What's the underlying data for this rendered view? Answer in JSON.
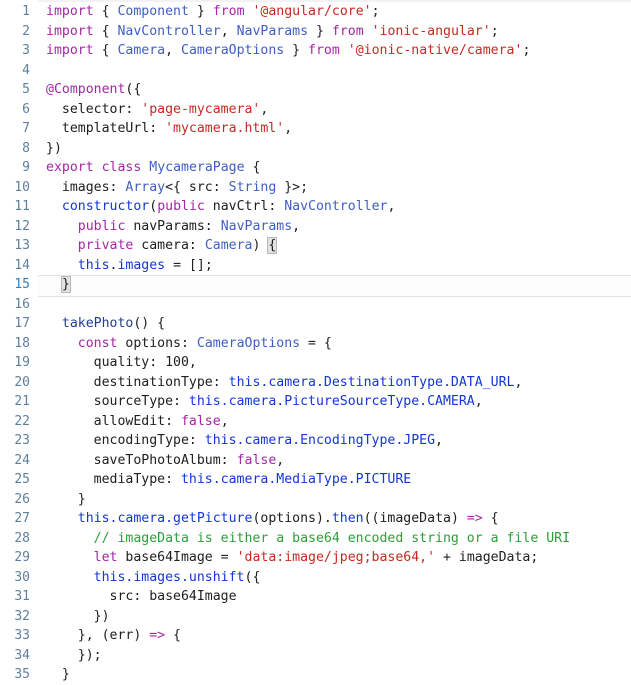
{
  "editor": {
    "name": "code-editor",
    "language": "TypeScript",
    "current_line": 15,
    "gutter": {
      "first_line": 1,
      "last_line": 35
    },
    "colors": {
      "background": "#ffffff",
      "line_number": "#5f7f9f",
      "current_line_number": "#2f7fbf",
      "keyword": "#a626a4",
      "type": "#3f5fc0",
      "string": "#c32b22",
      "comment": "#2d9e38",
      "member": "#1436d6",
      "function": "#1e3f8f",
      "plain_text": "#202020",
      "bracket_match_bg": "#e2e2e2",
      "current_line_border": "#e4e4e4"
    }
  },
  "lines": [
    {
      "n": "1",
      "tokens": [
        {
          "t": "kw",
          "v": "import"
        },
        {
          "t": "plain",
          "v": " { "
        },
        {
          "t": "type",
          "v": "Component"
        },
        {
          "t": "plain",
          "v": " } "
        },
        {
          "t": "kw",
          "v": "from"
        },
        {
          "t": "plain",
          "v": " "
        },
        {
          "t": "str",
          "v": "'@angular/core'"
        },
        {
          "t": "plain",
          "v": ";"
        }
      ]
    },
    {
      "n": "2",
      "tokens": [
        {
          "t": "kw",
          "v": "import"
        },
        {
          "t": "plain",
          "v": " { "
        },
        {
          "t": "type",
          "v": "NavController"
        },
        {
          "t": "plain",
          "v": ", "
        },
        {
          "t": "type",
          "v": "NavParams"
        },
        {
          "t": "plain",
          "v": " } "
        },
        {
          "t": "kw",
          "v": "from"
        },
        {
          "t": "plain",
          "v": " "
        },
        {
          "t": "str",
          "v": "'ionic-angular'"
        },
        {
          "t": "plain",
          "v": ";"
        }
      ]
    },
    {
      "n": "3",
      "tokens": [
        {
          "t": "kw",
          "v": "import"
        },
        {
          "t": "plain",
          "v": " { "
        },
        {
          "t": "type",
          "v": "Camera"
        },
        {
          "t": "plain",
          "v": ", "
        },
        {
          "t": "type",
          "v": "CameraOptions"
        },
        {
          "t": "plain",
          "v": " } "
        },
        {
          "t": "kw",
          "v": "from"
        },
        {
          "t": "plain",
          "v": " "
        },
        {
          "t": "str",
          "v": "'@ionic-native/camera'"
        },
        {
          "t": "plain",
          "v": ";"
        }
      ]
    },
    {
      "n": "4",
      "tokens": []
    },
    {
      "n": "5",
      "tokens": [
        {
          "t": "kw",
          "v": "@Component"
        },
        {
          "t": "plain",
          "v": "({"
        }
      ]
    },
    {
      "n": "6",
      "tokens": [
        {
          "t": "plain",
          "v": "  selector: "
        },
        {
          "t": "str",
          "v": "'page-mycamera'"
        },
        {
          "t": "plain",
          "v": ","
        }
      ]
    },
    {
      "n": "7",
      "tokens": [
        {
          "t": "plain",
          "v": "  templateUrl: "
        },
        {
          "t": "str",
          "v": "'mycamera.html'"
        },
        {
          "t": "plain",
          "v": ","
        }
      ]
    },
    {
      "n": "8",
      "tokens": [
        {
          "t": "plain",
          "v": "})"
        }
      ]
    },
    {
      "n": "9",
      "tokens": [
        {
          "t": "kw",
          "v": "export"
        },
        {
          "t": "plain",
          "v": " "
        },
        {
          "t": "kw",
          "v": "class"
        },
        {
          "t": "plain",
          "v": " "
        },
        {
          "t": "type",
          "v": "MycameraPage"
        },
        {
          "t": "plain",
          "v": " {"
        }
      ]
    },
    {
      "n": "10",
      "tokens": [
        {
          "t": "plain",
          "v": "  images: "
        },
        {
          "t": "type",
          "v": "Array"
        },
        {
          "t": "plain",
          "v": "<{ src: "
        },
        {
          "t": "type",
          "v": "String"
        },
        {
          "t": "plain",
          "v": " }>;"
        }
      ]
    },
    {
      "n": "11",
      "tokens": [
        {
          "t": "plain",
          "v": "  "
        },
        {
          "t": "ctor",
          "v": "constructor"
        },
        {
          "t": "plain",
          "v": "("
        },
        {
          "t": "kw",
          "v": "public"
        },
        {
          "t": "plain",
          "v": " navCtrl: "
        },
        {
          "t": "type",
          "v": "NavController"
        },
        {
          "t": "plain",
          "v": ","
        }
      ]
    },
    {
      "n": "12",
      "tokens": [
        {
          "t": "plain",
          "v": "    "
        },
        {
          "t": "kw",
          "v": "public"
        },
        {
          "t": "plain",
          "v": " navParams: "
        },
        {
          "t": "type",
          "v": "NavParams"
        },
        {
          "t": "plain",
          "v": ","
        }
      ]
    },
    {
      "n": "13",
      "tokens": [
        {
          "t": "plain",
          "v": "    "
        },
        {
          "t": "kw",
          "v": "private"
        },
        {
          "t": "plain",
          "v": " camera: "
        },
        {
          "t": "type",
          "v": "Camera"
        },
        {
          "t": "plain",
          "v": ") "
        },
        {
          "t": "brk",
          "v": "{"
        }
      ]
    },
    {
      "n": "14",
      "tokens": [
        {
          "t": "plain",
          "v": "    "
        },
        {
          "t": "thisref",
          "v": "this"
        },
        {
          "t": "plain",
          "v": "."
        },
        {
          "t": "thisref",
          "v": "images"
        },
        {
          "t": "plain",
          "v": " = [];"
        }
      ]
    },
    {
      "n": "15",
      "tokens": [
        {
          "t": "plain",
          "v": "  "
        },
        {
          "t": "brk",
          "v": "}"
        }
      ],
      "current": true
    },
    {
      "n": "16",
      "tokens": []
    },
    {
      "n": "17",
      "tokens": [
        {
          "t": "plain",
          "v": "  "
        },
        {
          "t": "fn",
          "v": "takePhoto"
        },
        {
          "t": "plain",
          "v": "() {"
        }
      ]
    },
    {
      "n": "18",
      "tokens": [
        {
          "t": "plain",
          "v": "    "
        },
        {
          "t": "kw",
          "v": "const"
        },
        {
          "t": "plain",
          "v": " options: "
        },
        {
          "t": "type",
          "v": "CameraOptions"
        },
        {
          "t": "plain",
          "v": " = {"
        }
      ]
    },
    {
      "n": "19",
      "tokens": [
        {
          "t": "plain",
          "v": "      quality: "
        },
        {
          "t": "num",
          "v": "100"
        },
        {
          "t": "plain",
          "v": ","
        }
      ]
    },
    {
      "n": "20",
      "tokens": [
        {
          "t": "plain",
          "v": "      destinationType: "
        },
        {
          "t": "thisref",
          "v": "this.camera.DestinationType.DATA_URL"
        },
        {
          "t": "plain",
          "v": ","
        }
      ]
    },
    {
      "n": "21",
      "tokens": [
        {
          "t": "plain",
          "v": "      sourceType: "
        },
        {
          "t": "thisref",
          "v": "this.camera.PictureSourceType.CAMERA"
        },
        {
          "t": "plain",
          "v": ","
        }
      ]
    },
    {
      "n": "22",
      "tokens": [
        {
          "t": "plain",
          "v": "      allowEdit: "
        },
        {
          "t": "kw",
          "v": "false"
        },
        {
          "t": "plain",
          "v": ","
        }
      ]
    },
    {
      "n": "23",
      "tokens": [
        {
          "t": "plain",
          "v": "      encodingType: "
        },
        {
          "t": "thisref",
          "v": "this.camera.EncodingType.JPEG"
        },
        {
          "t": "plain",
          "v": ","
        }
      ]
    },
    {
      "n": "24",
      "tokens": [
        {
          "t": "plain",
          "v": "      saveToPhotoAlbum: "
        },
        {
          "t": "kw",
          "v": "false"
        },
        {
          "t": "plain",
          "v": ","
        }
      ]
    },
    {
      "n": "25",
      "tokens": [
        {
          "t": "plain",
          "v": "      mediaType: "
        },
        {
          "t": "thisref",
          "v": "this.camera.MediaType.PICTURE"
        }
      ]
    },
    {
      "n": "26",
      "tokens": [
        {
          "t": "plain",
          "v": "    }"
        }
      ]
    },
    {
      "n": "27",
      "tokens": [
        {
          "t": "plain",
          "v": "    "
        },
        {
          "t": "thisref",
          "v": "this.camera.getPicture"
        },
        {
          "t": "plain",
          "v": "(options)."
        },
        {
          "t": "thisref",
          "v": "then"
        },
        {
          "t": "plain",
          "v": "((imageData) "
        },
        {
          "t": "arrow",
          "v": "=>"
        },
        {
          "t": "plain",
          "v": " {"
        }
      ]
    },
    {
      "n": "28",
      "tokens": [
        {
          "t": "plain",
          "v": "      "
        },
        {
          "t": "cmt",
          "v": "// imageData is either a base64 encoded string or a file URI"
        }
      ]
    },
    {
      "n": "29",
      "tokens": [
        {
          "t": "plain",
          "v": "      "
        },
        {
          "t": "kw",
          "v": "let"
        },
        {
          "t": "plain",
          "v": " base64Image = "
        },
        {
          "t": "str",
          "v": "'data:image/jpeg;base64,'"
        },
        {
          "t": "plain",
          "v": " + imageData;"
        }
      ]
    },
    {
      "n": "30",
      "tokens": [
        {
          "t": "plain",
          "v": "      "
        },
        {
          "t": "thisref",
          "v": "this.images.unshift"
        },
        {
          "t": "plain",
          "v": "({"
        }
      ]
    },
    {
      "n": "31",
      "tokens": [
        {
          "t": "plain",
          "v": "        src: base64Image"
        }
      ]
    },
    {
      "n": "32",
      "tokens": [
        {
          "t": "plain",
          "v": "      })"
        }
      ]
    },
    {
      "n": "33",
      "tokens": [
        {
          "t": "plain",
          "v": "    }, (err) "
        },
        {
          "t": "arrow",
          "v": "=>"
        },
        {
          "t": "plain",
          "v": " {"
        }
      ]
    },
    {
      "n": "34",
      "tokens": [
        {
          "t": "plain",
          "v": "    });"
        }
      ]
    },
    {
      "n": "35",
      "tokens": [
        {
          "t": "plain",
          "v": "  }"
        }
      ]
    }
  ]
}
